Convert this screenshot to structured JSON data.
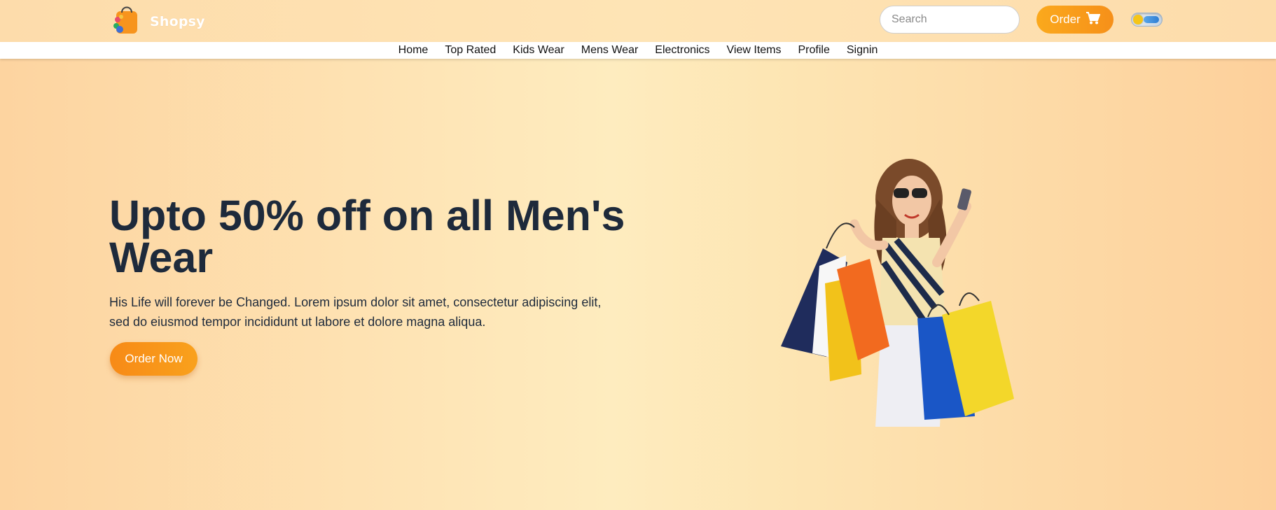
{
  "header": {
    "brand": "Shopsy",
    "search_placeholder": "Search",
    "order_label": "Order"
  },
  "nav": {
    "items": [
      "Home",
      "Top Rated",
      "Kids Wear",
      "Mens Wear",
      "Electronics",
      "View Items",
      "Profile",
      "Signin"
    ]
  },
  "hero": {
    "title": "Upto 50% off on all Men's Wear",
    "description": "His Life will forever be Changed. Lorem ipsum dolor sit amet, consectetur adipiscing elit, sed do eiusmod tempor incididunt ut labore et dolore magna aliqua.",
    "cta_label": "Order Now"
  },
  "colors": {
    "accent": "#f7931a",
    "heading": "#1e2a3b"
  },
  "icons": {
    "logo": "shopping-bag-icon",
    "search": "search-icon",
    "cart": "cart-icon",
    "theme_toggle": "dark-mode-toggle"
  }
}
